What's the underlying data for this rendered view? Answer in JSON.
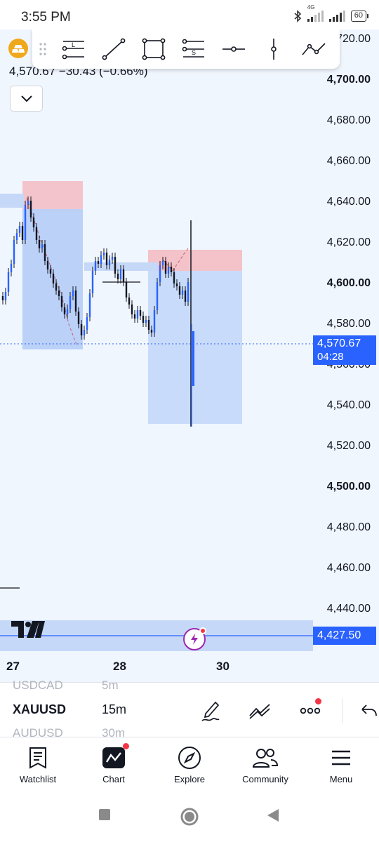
{
  "status_bar": {
    "time": "3:55 PM",
    "network": "4G",
    "battery": "60"
  },
  "chart": {
    "price_summary": "4,570.67  −30.43 (−0.66%)",
    "price_ticks": [
      {
        "label": "4,720.00",
        "bold": false
      },
      {
        "label": "4,700.00",
        "bold": true
      },
      {
        "label": "4,680.00",
        "bold": false
      },
      {
        "label": "4,660.00",
        "bold": false
      },
      {
        "label": "4,640.00",
        "bold": false
      },
      {
        "label": "4,620.00",
        "bold": false
      },
      {
        "label": "4,600.00",
        "bold": true
      },
      {
        "label": "4,580.00",
        "bold": false
      },
      {
        "label": "4,560.00",
        "bold": false
      },
      {
        "label": "4,540.00",
        "bold": false
      },
      {
        "label": "4,520.00",
        "bold": false
      },
      {
        "label": "4,500.00",
        "bold": true
      },
      {
        "label": "4,480.00",
        "bold": false
      },
      {
        "label": "4,460.00",
        "bold": false
      },
      {
        "label": "4,440.00",
        "bold": false
      }
    ],
    "current_price": "4,570.67",
    "countdown": "04:28",
    "low_price": "4,427.50",
    "time_labels": [
      "27",
      "28",
      "30"
    ],
    "colors": {
      "accent": "#2962ff",
      "chart_bg": "#f0f6fd",
      "stop_zone": "#f5b8c0",
      "target_zone": "#a9c4f5"
    },
    "toolbar_icons": [
      "long-position-icon",
      "trend-line-icon",
      "rectangle-icon",
      "short-position-icon",
      "horizontal-ray-icon",
      "vertical-line-icon",
      "path-icon"
    ]
  },
  "symbol_row": {
    "symbol_above": "USDCAD",
    "timeframe_above": "5m",
    "symbol": "XAUUSD",
    "timeframe": "15m",
    "symbol_below": "AUDUSD",
    "timeframe_below": "30m"
  },
  "bottom_nav": [
    {
      "label": "Watchlist",
      "icon": "watchlist-icon"
    },
    {
      "label": "Chart",
      "icon": "chart-icon"
    },
    {
      "label": "Explore",
      "icon": "compass-icon"
    },
    {
      "label": "Community",
      "icon": "people-icon"
    },
    {
      "label": "Menu",
      "icon": "menu-icon"
    }
  ]
}
